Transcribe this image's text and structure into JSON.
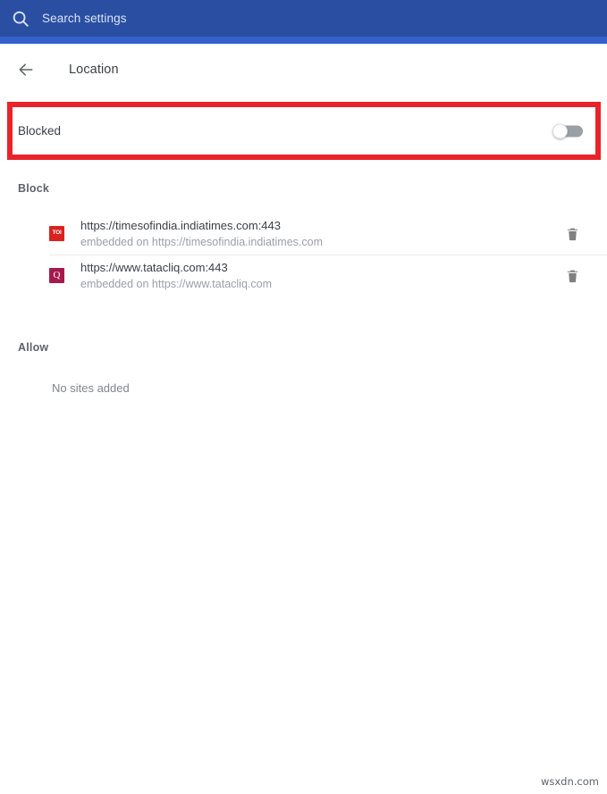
{
  "colors": {
    "header_blue": "#2a4fa2",
    "header_strip_blue": "#3461cc",
    "highlight_red": "#e8242a",
    "toi_red": "#d9231e",
    "tatacliq_magenta": "#a6194c",
    "text_primary": "#3c4043",
    "text_secondary": "#9aa0a6",
    "toggle_track_off": "#9aa0a6"
  },
  "search": {
    "icon": "search-icon",
    "placeholder": "Search settings",
    "value": ""
  },
  "sub_header": {
    "back_icon": "arrow-left-icon",
    "title": "Location"
  },
  "permission_toggle": {
    "label": "Blocked",
    "state": "off",
    "highlighted": true
  },
  "sections": [
    {
      "id": "block",
      "heading": "Block",
      "empty_text": "",
      "sites": [
        {
          "favicon": "toi-favicon",
          "favicon_text": "TOI",
          "url": "https://timesofindia.indiatimes.com:443",
          "embedded": "embedded on https://timesofindia.indiatimes.com",
          "delete_icon": "trash-icon"
        },
        {
          "favicon": "tatacliq-favicon",
          "favicon_text": "Q",
          "url": "https://www.tatacliq.com:443",
          "embedded": "embedded on https://www.tatacliq.com",
          "delete_icon": "trash-icon"
        }
      ]
    },
    {
      "id": "allow",
      "heading": "Allow",
      "empty_text": "No sites added",
      "sites": []
    }
  ],
  "watermark": "wsxdn.com"
}
